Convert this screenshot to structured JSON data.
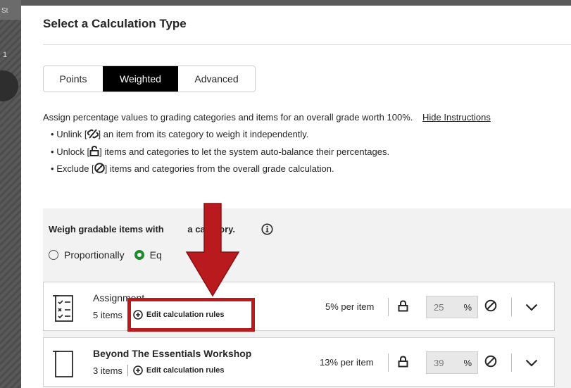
{
  "background": {
    "corner_label": "St",
    "side_number": "1"
  },
  "dialog": {
    "title": "Select a Calculation Type"
  },
  "tabs": [
    {
      "label": "Points",
      "selected": false
    },
    {
      "label": "Weighted",
      "selected": true
    },
    {
      "label": "Advanced",
      "selected": false
    }
  ],
  "instructions": {
    "text": "Assign percentage values to grading categories and items for an overall grade worth 100%.",
    "hide_link": "Hide Instructions",
    "bullets": [
      {
        "prefix": "Unlink [",
        "icon": "unlink-icon",
        "suffix": "] an item from its category to weigh it independently."
      },
      {
        "prefix": "Unlock [",
        "icon": "unlock-icon",
        "suffix": "] items and categories to let the system auto-balance their percentages."
      },
      {
        "prefix": "Exclude [",
        "icon": "exclude-icon",
        "suffix": "] items and categories from the overall grade calculation."
      }
    ]
  },
  "weigh": {
    "label": "Weigh gradable items with",
    "label_tail": "a category.",
    "options": [
      {
        "label": "Proportionally",
        "selected": false
      },
      {
        "label": "Eq",
        "selected": true
      }
    ]
  },
  "categories": [
    {
      "title": "Assignment",
      "count": "5 items",
      "edit_label": "Edit calculation rules",
      "per_item": "5% per item",
      "percent": "25",
      "percent_sign": "%"
    },
    {
      "title": "Beyond The Essentials Workshop",
      "count": "3 items",
      "edit_label": "Edit calculation rules",
      "per_item": "13% per item",
      "percent": "39",
      "percent_sign": "%"
    }
  ],
  "colors": {
    "selected_tab_bg": "#000000",
    "radio_selected": "#1e8a2e",
    "annotation_red": "#b81a1e"
  }
}
